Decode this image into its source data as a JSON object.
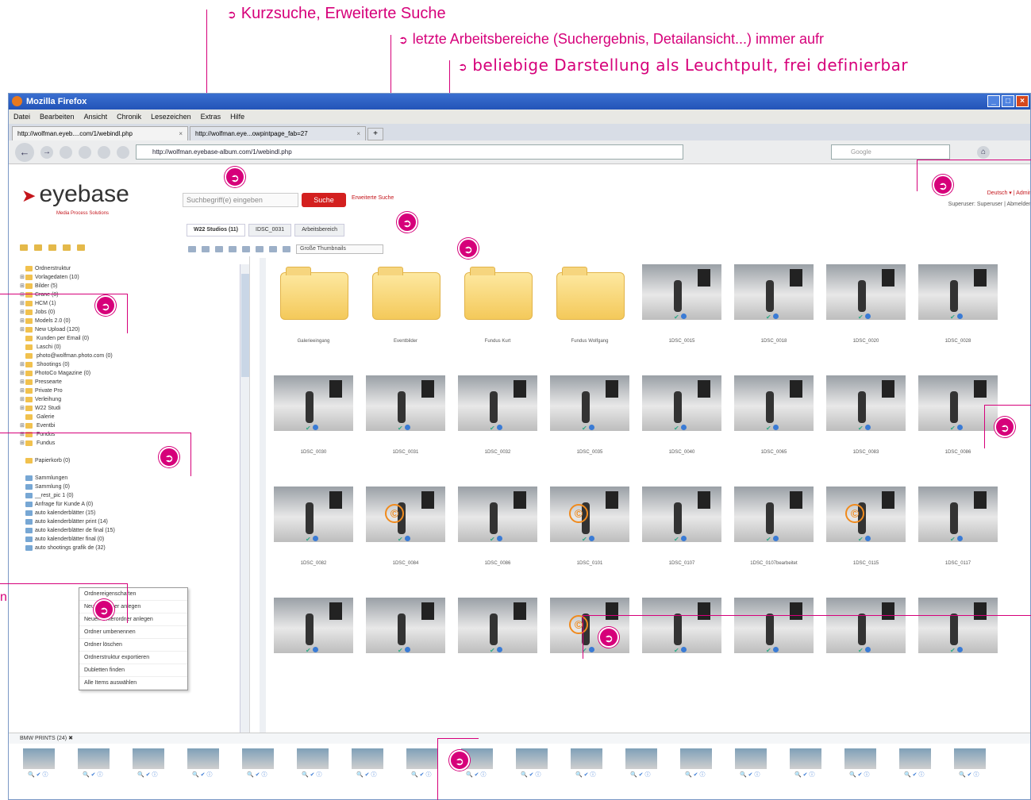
{
  "annotations": {
    "a1": "Kurzsuche, Erweiterte Suche",
    "a2": "letzte Arbeitsbereiche (Suchergebnis, Detailansicht...) immer aufr",
    "a3": "beliebige Darstellung als Leuchtpult, frei definierbar",
    "left_partial": "n",
    "bullet": "➲",
    "arrow": "➲"
  },
  "browser": {
    "title": "Mozilla Firefox",
    "menu": [
      "Datei",
      "Bearbeiten",
      "Ansicht",
      "Chronik",
      "Lesezeichen",
      "Extras",
      "Hilfe"
    ],
    "tabs": [
      {
        "label": "http://wolfman.eyeb....com/1/webindl.php"
      },
      {
        "label": "http://wolfman.eye...owpintpage_fab=27"
      }
    ],
    "newtab": "+",
    "tab_close": "×",
    "url": "http://wolfman.eyebase-album.com/1/webindl.php",
    "search_placeholder": "Google",
    "controls": {
      "min": "_",
      "max": "□",
      "close": "×"
    },
    "nav": {
      "back": "←",
      "fwd": "→",
      "home": "⌂"
    }
  },
  "app": {
    "logo": "eyebase",
    "logo_mark": "➤",
    "logo_sub": "Media Process Solutions",
    "search_placeholder": "Suchbegriff(e) eingeben",
    "search_button": "Suche",
    "advanced_search": "Erweiterte Suche",
    "user_line1": "Deutsch ▾ | Admin",
    "user_line2": "Superuser: Superuser | Abmelden",
    "ws_tabs": [
      "W22 Studios (11)",
      "IDSC_0031",
      "Arbeitsbereich"
    ],
    "view_mode": "Große Thumbnails",
    "tree": [
      {
        "label": "Ordnerstruktur",
        "ex": ""
      },
      {
        "label": "Vorlagedaten (10)",
        "ex": "⊞"
      },
      {
        "label": "Bilder (5)",
        "ex": "⊞"
      },
      {
        "label": "Crane (8)",
        "ex": "⊞"
      },
      {
        "label": "HCM (1)",
        "ex": "⊞"
      },
      {
        "label": "Jobs (0)",
        "ex": "⊞"
      },
      {
        "label": "Models 2.0 (0)",
        "ex": "⊞"
      },
      {
        "label": "New Upload (120)",
        "ex": "⊞"
      },
      {
        "label": "  Kunden per Email (0)",
        "ex": ""
      },
      {
        "label": "  Laschi (0)",
        "ex": ""
      },
      {
        "label": "  photo@wolfman.photo.com (0)",
        "ex": ""
      },
      {
        "label": "  Shootings (0)",
        "ex": "⊞"
      },
      {
        "label": "PhotoCo Magazine (0)",
        "ex": "⊞"
      },
      {
        "label": "Pressearte",
        "ex": "⊞"
      },
      {
        "label": "Private Pro",
        "ex": "⊞"
      },
      {
        "label": "Verleihung",
        "ex": "⊞"
      },
      {
        "label": "W22 Studi",
        "ex": "⊞"
      },
      {
        "label": "  Galerie",
        "ex": ""
      },
      {
        "label": "  Eventbi",
        "ex": "⊞"
      },
      {
        "label": "  Fundus",
        "ex": "⊞"
      },
      {
        "label": "  Fundus",
        "ex": "⊞"
      },
      {
        "label": "",
        "ex": ""
      },
      {
        "label": "Papierkorb (0)",
        "ex": ""
      },
      {
        "label": "",
        "ex": ""
      },
      {
        "label": "Sammlungen",
        "ex": ""
      },
      {
        "label": "Sammlung (0)",
        "ex": ""
      },
      {
        "label": "__rest_pic 1 (0)",
        "ex": ""
      },
      {
        "label": "Anfrage für Kunde A (0)",
        "ex": ""
      },
      {
        "label": "auto kalenderblätter (15)",
        "ex": ""
      },
      {
        "label": "auto kalenderblätter print (14)",
        "ex": ""
      },
      {
        "label": "auto kalenderblätter de final (15)",
        "ex": ""
      },
      {
        "label": "auto kalenderblätter final (0)",
        "ex": ""
      },
      {
        "label": "auto shootings grafik de (32)",
        "ex": ""
      }
    ],
    "context_menu": [
      "Ordnereigenschaften",
      "Neuen Ordner anlegen",
      "Neuen Unterordner anlegen",
      "Ordner umbenennen",
      "Ordner löschen",
      "Ordnerstruktur exportieren",
      "Dubletten finden",
      "Alle Items auswählen"
    ],
    "grid": [
      {
        "cap": "Galerieeingang",
        "type": "folder"
      },
      {
        "cap": "Eventbilder",
        "type": "folder"
      },
      {
        "cap": "Fundus Kurt",
        "type": "folder"
      },
      {
        "cap": "Fundus Wolfgang",
        "type": "folder"
      },
      {
        "cap": "1DSC_0015",
        "type": "photo"
      },
      {
        "cap": "1DSC_0018",
        "type": "photo"
      },
      {
        "cap": "1DSC_0020",
        "type": "photo"
      },
      {
        "cap": "1DSC_0028",
        "type": "photo"
      },
      {
        "cap": "1DSC_0030",
        "type": "photo"
      },
      {
        "cap": "1DSC_0031",
        "type": "photo"
      },
      {
        "cap": "1DSC_0032",
        "type": "photo"
      },
      {
        "cap": "1DSC_0035",
        "type": "photo"
      },
      {
        "cap": "1DSC_0040",
        "type": "photo"
      },
      {
        "cap": "1DSC_0065",
        "type": "photo"
      },
      {
        "cap": "1DSC_0083",
        "type": "photo"
      },
      {
        "cap": "1DSC_0086",
        "type": "photo"
      },
      {
        "cap": "1DSC_0082",
        "type": "photo"
      },
      {
        "cap": "1DSC_0084",
        "type": "photo",
        "copy": true
      },
      {
        "cap": "1DSC_0086",
        "type": "photo"
      },
      {
        "cap": "1DSC_0101",
        "type": "photo",
        "copy": true
      },
      {
        "cap": "1DSC_0107",
        "type": "photo"
      },
      {
        "cap": "1DSC_0107bearbeitet",
        "type": "photo"
      },
      {
        "cap": "1DSC_0115",
        "type": "photo",
        "copy": true
      },
      {
        "cap": "1DSC_0117",
        "type": "photo"
      },
      {
        "cap": "",
        "type": "photo"
      },
      {
        "cap": "",
        "type": "photo"
      },
      {
        "cap": "",
        "type": "photo"
      },
      {
        "cap": "",
        "type": "photo",
        "copy": true
      },
      {
        "cap": "",
        "type": "photo"
      },
      {
        "cap": "",
        "type": "photo"
      },
      {
        "cap": "",
        "type": "photo"
      },
      {
        "cap": "",
        "type": "photo"
      }
    ],
    "copy_symbol": "©",
    "lightbox_title": "BMW PRINTS (24)",
    "lightbox_close": "✖",
    "lightbox_icons": "🔍 ✔ ⓘ",
    "lightbox_count": 24
  }
}
